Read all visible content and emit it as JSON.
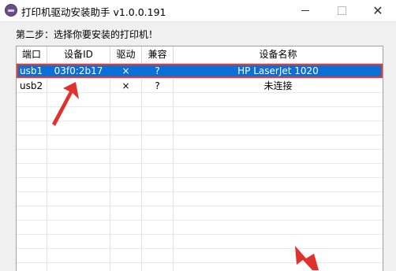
{
  "window": {
    "title": "打印机驱动安装助手 v1.0.0.191",
    "minimize_glyph": "",
    "maximize_glyph": "",
    "close_glyph": "✕"
  },
  "step": {
    "text": "第二步：选择你要安装的打印机！"
  },
  "table": {
    "columns": [
      "端口",
      "设备ID",
      "驱动",
      "兼容",
      "设备名称"
    ],
    "rows": [
      {
        "port": "usb1",
        "device_id": "03f0:2b17",
        "driver": "×",
        "compat": "?",
        "name": "HP LaserJet 1020",
        "selected": true
      },
      {
        "port": "usb2",
        "device_id": "",
        "driver": "×",
        "compat": "?",
        "name": "未连接",
        "selected": false
      }
    ]
  },
  "colors": {
    "selection": "#0a6fd6",
    "highlight_border": "#e53935",
    "annotation_arrow": "#e0322c"
  }
}
